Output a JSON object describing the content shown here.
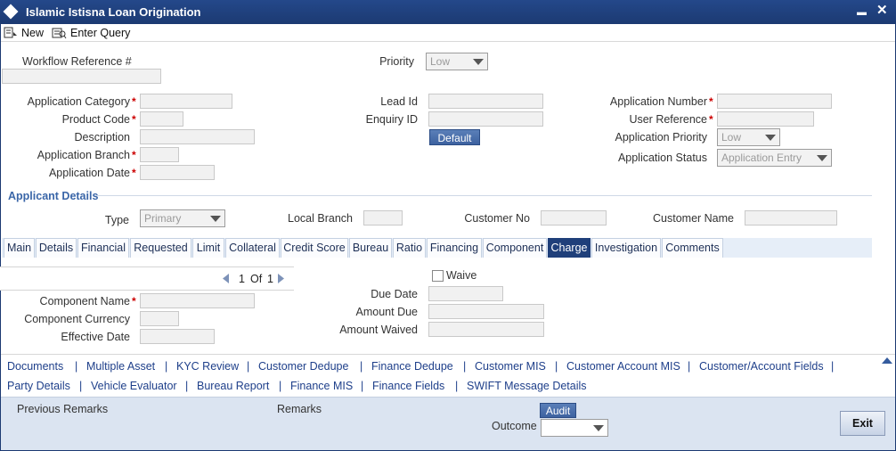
{
  "window": {
    "title": "Islamic Istisna Loan Origination",
    "minimize": "▬",
    "close": "✕"
  },
  "toolbar": {
    "new_label": "New",
    "enter_query_label": "Enter Query"
  },
  "header": {
    "workflow_ref_label": "Workflow Reference #",
    "workflow_ref_value": "",
    "priority_label": "Priority",
    "priority_value": "Low"
  },
  "application": {
    "category_label": "Application Category",
    "product_code_label": "Product Code",
    "description_label": "Description",
    "branch_label": "Application Branch",
    "date_label": "Application Date",
    "lead_id_label": "Lead Id",
    "enquiry_id_label": "Enquiry ID",
    "default_button": "Default",
    "number_label": "Application Number",
    "user_ref_label": "User Reference",
    "app_priority_label": "Application Priority",
    "app_priority_value": "Low",
    "status_label": "Application Status",
    "status_value": "Application Entry",
    "required_mark": "*"
  },
  "applicant": {
    "section_title": "Applicant Details",
    "type_label": "Type",
    "type_value": "Primary",
    "local_branch_label": "Local Branch",
    "customer_no_label": "Customer No",
    "customer_name_label": "Customer Name"
  },
  "tabs": [
    "Main",
    "Details",
    "Financial",
    "Requested",
    "Limit",
    "Collateral",
    "Credit Score",
    "Bureau",
    "Ratio",
    "Financing",
    "Component",
    "Charge",
    "Investigation",
    "Comments"
  ],
  "active_tab": "Charge",
  "charge": {
    "pager_current": "1",
    "pager_of": "Of",
    "pager_total": "1",
    "component_name_label": "Component Name",
    "component_currency_label": "Component Currency",
    "effective_date_label": "Effective Date",
    "waive_label": "Waive",
    "due_date_label": "Due Date",
    "amount_due_label": "Amount Due",
    "amount_waived_label": "Amount Waived"
  },
  "links_row1": [
    "Documents",
    "Multiple Asset",
    "KYC Review",
    "Customer Dedupe",
    "Finance Dedupe",
    "Customer MIS",
    "Customer Account MIS",
    "Customer/Account Fields"
  ],
  "links_row2": [
    "Party Details",
    "Vehicle Evaluator",
    "Bureau Report",
    "Finance MIS",
    "Finance Fields",
    "SWIFT Message Details"
  ],
  "link_separator": "|",
  "footer": {
    "previous_remarks_label": "Previous Remarks",
    "remarks_label": "Remarks",
    "audit_button": "Audit",
    "outcome_label": "Outcome",
    "outcome_value": "",
    "exit_button": "Exit"
  }
}
